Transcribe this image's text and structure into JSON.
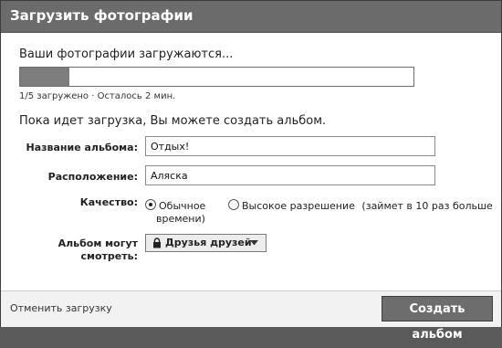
{
  "dialog": {
    "title": "Загрузить фотографии"
  },
  "upload": {
    "status": "Ваши фотографии загружаются...",
    "progress_fraction": 0.125,
    "progress_text": "1/5 загружено · Осталось 2 мин."
  },
  "hint": "Пока идет загрузка, Вы можете создать альбом.",
  "form": {
    "album_name_label": "Название альбома:",
    "album_name_value": "Отдых!",
    "location_label": "Расположение:",
    "location_value": "Аляска",
    "quality_label": "Качество:",
    "quality_normal": "Обычное",
    "quality_high": "Высокое разрешение",
    "quality_high_note_line1": "(займет в 10 раз больше",
    "quality_high_note_line2": "времени)",
    "selected_quality": "normal",
    "privacy_label_line1": "Альбом могут",
    "privacy_label_line2": "смотреть:",
    "privacy_value": "Друзья друзей"
  },
  "footer": {
    "cancel_label": "Отменить загрузку",
    "create_label": "Создать альбом"
  },
  "colors": {
    "title_bar": "#6b6b6b",
    "progress_fill": "#7d7d7d",
    "primary_button": "#6d6d6d"
  },
  "icons": {
    "privacy": "lock-icon",
    "dropdown": "caret-down-icon"
  }
}
